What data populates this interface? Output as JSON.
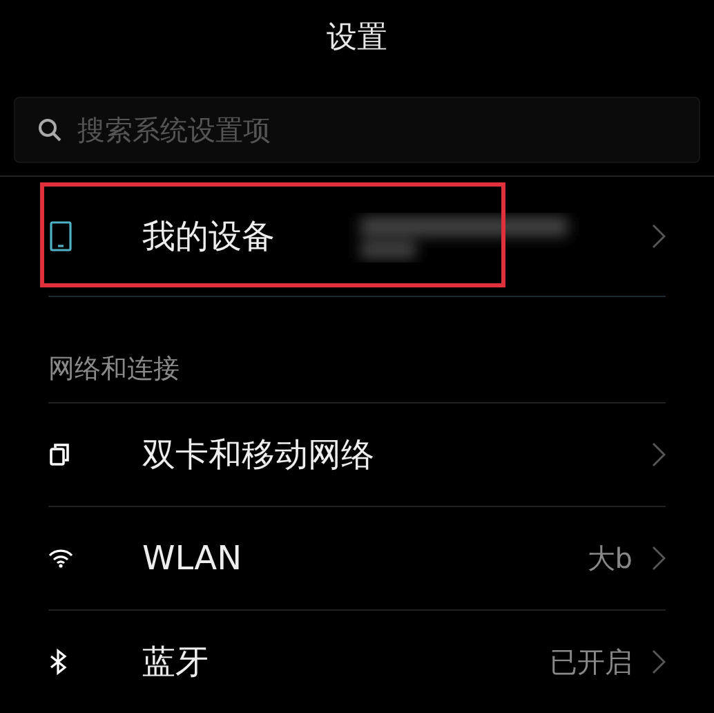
{
  "title": "设置",
  "search": {
    "placeholder": "搜索系统设置项"
  },
  "device_row": {
    "label": "我的设备",
    "highlighted": true
  },
  "sections": [
    {
      "header": "网络和连接",
      "items": [
        {
          "kind": "sim",
          "label": "双卡和移动网络"
        },
        {
          "kind": "wifi",
          "label": "WLAN",
          "value": "大b"
        },
        {
          "kind": "bluetooth",
          "label": "蓝牙",
          "value": "已开启"
        }
      ]
    }
  ]
}
